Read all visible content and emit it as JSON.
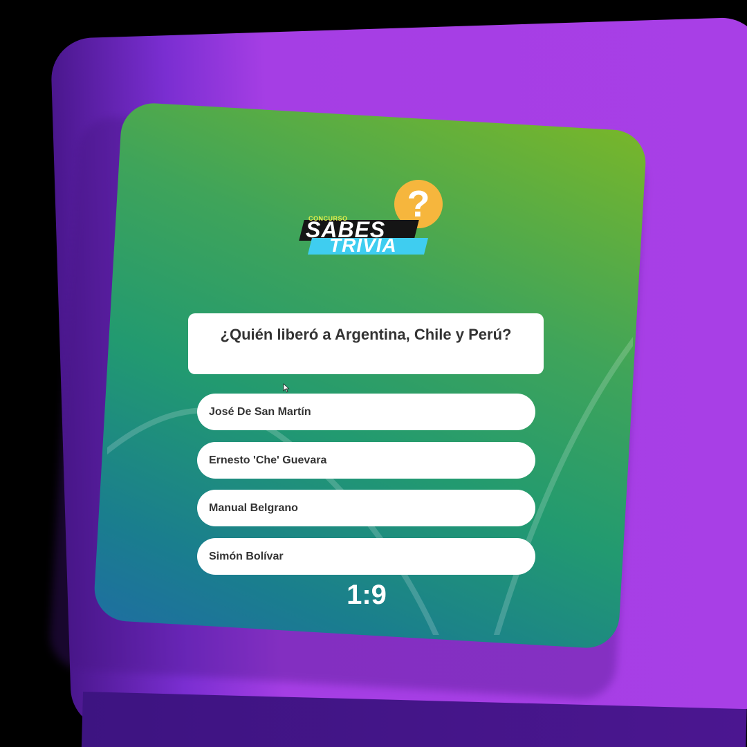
{
  "logo": {
    "small_text": "CONCURSO",
    "line1": "SABES",
    "line2": "TRIVIA",
    "badge": "?"
  },
  "question": {
    "text": "¿Quién liberó a Argentina, Chile y Perú?"
  },
  "answers": [
    {
      "label": "José De San Martín"
    },
    {
      "label": "Ernesto 'Che' Guevara"
    },
    {
      "label": "Manual Belgrano"
    },
    {
      "label": "Simón Bolívar"
    }
  ],
  "timer": {
    "text": "1:9"
  },
  "colors": {
    "purple": "#a83fe6",
    "green_top": "#78b62a",
    "teal_bottom": "#1e6fa0",
    "logo_badge": "#f6b63d",
    "logo_accent": "#3fcdf0"
  },
  "icons": {
    "cursor": "mouse-pointer-icon"
  }
}
